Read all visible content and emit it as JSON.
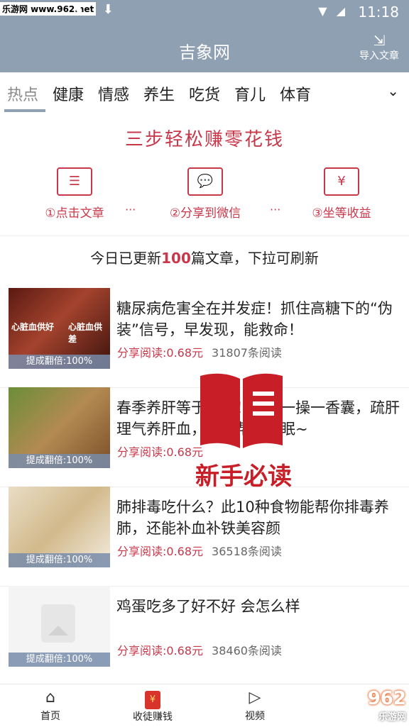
{
  "status_bar": {
    "watermark": "乐游网 www.962.net",
    "time": "11:18",
    "download_icons": "⬇ ⬇",
    "signal_icons": "▼ ◢"
  },
  "header": {
    "title": "吉象网",
    "import_label": "导入文章",
    "import_icon": "import-icon"
  },
  "tabs": {
    "items": [
      "热点",
      "健康",
      "情感",
      "养生",
      "吃货",
      "育儿",
      "体育"
    ],
    "active": "热点",
    "more_icon": "⌄"
  },
  "banner": {
    "title": "三步轻松赚零花钱",
    "steps": [
      {
        "icon": "☰",
        "label": "①点击文章"
      },
      {
        "icon": "💬",
        "label": "②分享到微信"
      },
      {
        "icon": "¥",
        "label": "③坐等收益"
      }
    ],
    "separator": "···"
  },
  "refresh_note": {
    "prefix": "今日已更新",
    "count": "100",
    "suffix": "篇文章，下拉可刷新"
  },
  "articles": [
    {
      "title": "糖尿病危害全在并发症！抓住高糖下的“伪装”信号，早发现，能救命！",
      "share": "分享阅读:0.68元",
      "reads": "31807条阅读",
      "caption": "提成翻倍:100%",
      "thumb_left_text": "心脏血供好",
      "thumb_right_text": "心脏血供差"
    },
    {
      "title": "春季养肝等于养命！一按一操一香囊，疏肝理气养肝血，还能帮助睡眠~",
      "share": "分享阅读:0.68元",
      "reads": "",
      "caption": "提成翻倍:100%",
      "thumb_left_text": "",
      "thumb_right_text": ""
    },
    {
      "title": "肺排毒吃什么？此10种食物能帮你排毒养肺，还能补血补铁美容颜",
      "share": "分享阅读:0.68元",
      "reads": "36518条阅读",
      "caption": "提成翻倍:100%",
      "thumb_left_text": "",
      "thumb_right_text": ""
    },
    {
      "title": "鸡蛋吃多了好不好 会怎么样",
      "share": "分享阅读:0.68元",
      "reads": "38460条阅读",
      "caption": "提成翻倍:100%",
      "thumb_left_text": "",
      "thumb_right_text": ""
    }
  ],
  "guide_overlay": {
    "label": "新手必读"
  },
  "bottom_nav": {
    "items": [
      {
        "label": "首页",
        "icon": "home-icon"
      },
      {
        "label": "收徒赚钱",
        "icon": "red-packet-icon"
      },
      {
        "label": "视频",
        "icon": "play-icon"
      }
    ],
    "logo": "962",
    "logo_sub": "乐游网"
  },
  "colors": {
    "header_bg": "#8fa0b3",
    "accent_red": "#c8384b",
    "caption_bg": "#788caa"
  }
}
